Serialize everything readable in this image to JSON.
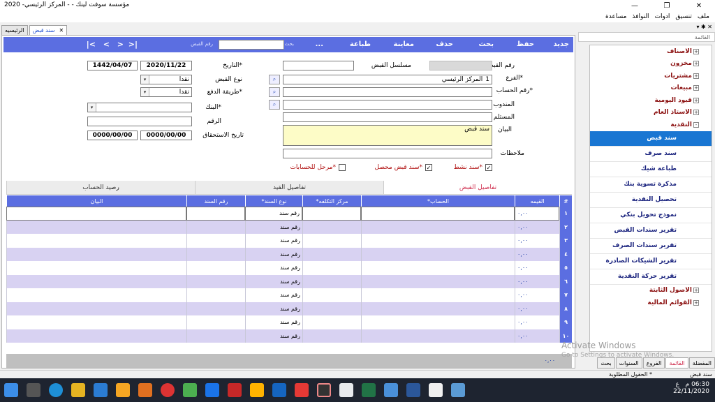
{
  "window": {
    "title": "مؤسسة سوفت لينك  -  - المركز الرئيسي- 2020"
  },
  "menu": [
    "ملف",
    "تنسيق",
    "ادوات",
    "النوافذ",
    "مساعدة"
  ],
  "doc_tabs": [
    {
      "label": "الرئيسيه"
    },
    {
      "label": "سند قبض"
    }
  ],
  "toolbar": {
    "new": "جديد",
    "save": "حفظ",
    "search": "بحث",
    "delete": "حذف",
    "preview": "معاينة",
    "print": "طباعة",
    "more": "...",
    "search_label": "بحث",
    "search_value": "",
    "receipt_no_label": "رقم القبض",
    "nav_first": "|<",
    "nav_prev": "<",
    "nav_next": ">",
    "nav_last": ">|"
  },
  "form": {
    "receipt_no_label": "رقم القبض",
    "receipt_no": "",
    "serial_label": "مسلسل القبض",
    "serial": "",
    "date_label": "*التاريخ",
    "date": "2020/11/22",
    "hijri": "1442/04/07",
    "branch_label": "*الفرع",
    "branch": "المركز الرئيسي",
    "branch_no": "1",
    "account_label": "*رقم الحساب",
    "account": "",
    "delegate_label": "المندوب",
    "delegate": "",
    "receiver_label": "المستلم",
    "receiver": "",
    "desc_label": "البيان",
    "desc": "سند قبض",
    "notes_label": "ملاحظات",
    "notes": "",
    "receipt_type_label": "نوع القبض",
    "receipt_type": "نقدا",
    "pay_method_label": "*طريقة الدفع",
    "pay_method": "نقدا",
    "bank_label": "*البنك",
    "bank": "",
    "number_label": "الرقم",
    "number": "",
    "due_date_label": "تاريخ الاستحقاق",
    "due_date": "0000/00/00",
    "due_date2": "0000/00/00",
    "active_label": "*سند نشط",
    "active": true,
    "collected_label": "*سند قبض محصل",
    "collected": true,
    "posted_label": "*مرحل للحسابات",
    "posted": false
  },
  "section_tabs": [
    "تفاصيل القبض",
    "تفاصيل القيد",
    "رصيد الحساب"
  ],
  "grid": {
    "headers": [
      "#",
      "القيمه",
      "الحساب*",
      "مركز التكلفه*",
      "نوع السند*",
      "رقم السند",
      "البيان"
    ],
    "rows": [
      {
        "n": "١",
        "amount": "٠,٠٠",
        "type": "رقم سند"
      },
      {
        "n": "٢",
        "amount": "٠,٠٠",
        "type": "رقم سند"
      },
      {
        "n": "٣",
        "amount": "٠,٠٠",
        "type": "رقم سند"
      },
      {
        "n": "٤",
        "amount": "٠,٠٠",
        "type": "رقم سند"
      },
      {
        "n": "٥",
        "amount": "٠,٠٠",
        "type": "رقم سند"
      },
      {
        "n": "٦",
        "amount": "٠,٠٠",
        "type": "رقم سند"
      },
      {
        "n": "٧",
        "amount": "٠,٠٠",
        "type": "رقم سند"
      },
      {
        "n": "٨",
        "amount": "٠,٠٠",
        "type": "رقم سند"
      },
      {
        "n": "٩",
        "amount": "٠,٠٠",
        "type": "رقم سند"
      },
      {
        "n": "١٠",
        "amount": "٠,٠٠",
        "type": "رقم سند"
      }
    ],
    "total": "٠,٠٠"
  },
  "sidebar": {
    "header": "القائمة",
    "items": [
      {
        "label": "الاصناف",
        "type": "group",
        "sign": "+"
      },
      {
        "label": "مخزون",
        "type": "group",
        "sign": "+"
      },
      {
        "label": "مشتريات",
        "type": "group",
        "sign": "+"
      },
      {
        "label": "مبيعات",
        "type": "group",
        "sign": "+"
      },
      {
        "label": "قيود اليومية",
        "type": "group",
        "sign": "+"
      },
      {
        "label": "الاستاذ العام",
        "type": "group",
        "sign": "+"
      },
      {
        "label": "النقدية",
        "type": "group",
        "sign": "-"
      },
      {
        "label": "سند قبض",
        "type": "sub",
        "selected": true
      },
      {
        "label": "سند صرف",
        "type": "sub"
      },
      {
        "label": "طباعة شيك",
        "type": "sub"
      },
      {
        "label": "مذكرة تسوية بنك",
        "type": "sub"
      },
      {
        "label": "تحصيل النقدية",
        "type": "sub"
      },
      {
        "label": "نموذج تحويل بنكي",
        "type": "sub"
      },
      {
        "label": "تقرير سندات القبض",
        "type": "sub"
      },
      {
        "label": "تقرير سندات الصرف",
        "type": "sub"
      },
      {
        "label": "تقرير الشيكات الصادرة",
        "type": "sub"
      },
      {
        "label": "تقرير حركة النقدية",
        "type": "sub"
      },
      {
        "label": "الاصول الثابتة",
        "type": "group",
        "sign": "+"
      },
      {
        "label": "القوائم المالية",
        "type": "group",
        "sign": "+"
      }
    ],
    "tabs": [
      "المفضلة",
      "القائمة",
      "الفروع",
      "السنوات",
      "بحث"
    ]
  },
  "status": {
    "left": "سند قبض",
    "right": "* الحقول المطلوبة"
  },
  "watermark": {
    "line1": "Activate Windows",
    "line2": "Go to Settings to activate Windows."
  },
  "taskbar": {
    "time": "06:30 م",
    "date": "22/11/2020",
    "lang": "ع"
  },
  "colors": {
    "toolbar": "#5b6ee1",
    "selected_row": "#19c3e8",
    "alt_row": "#d8d2f2",
    "tree_text": "#8b1010",
    "tree_sub": "#1a237e"
  }
}
